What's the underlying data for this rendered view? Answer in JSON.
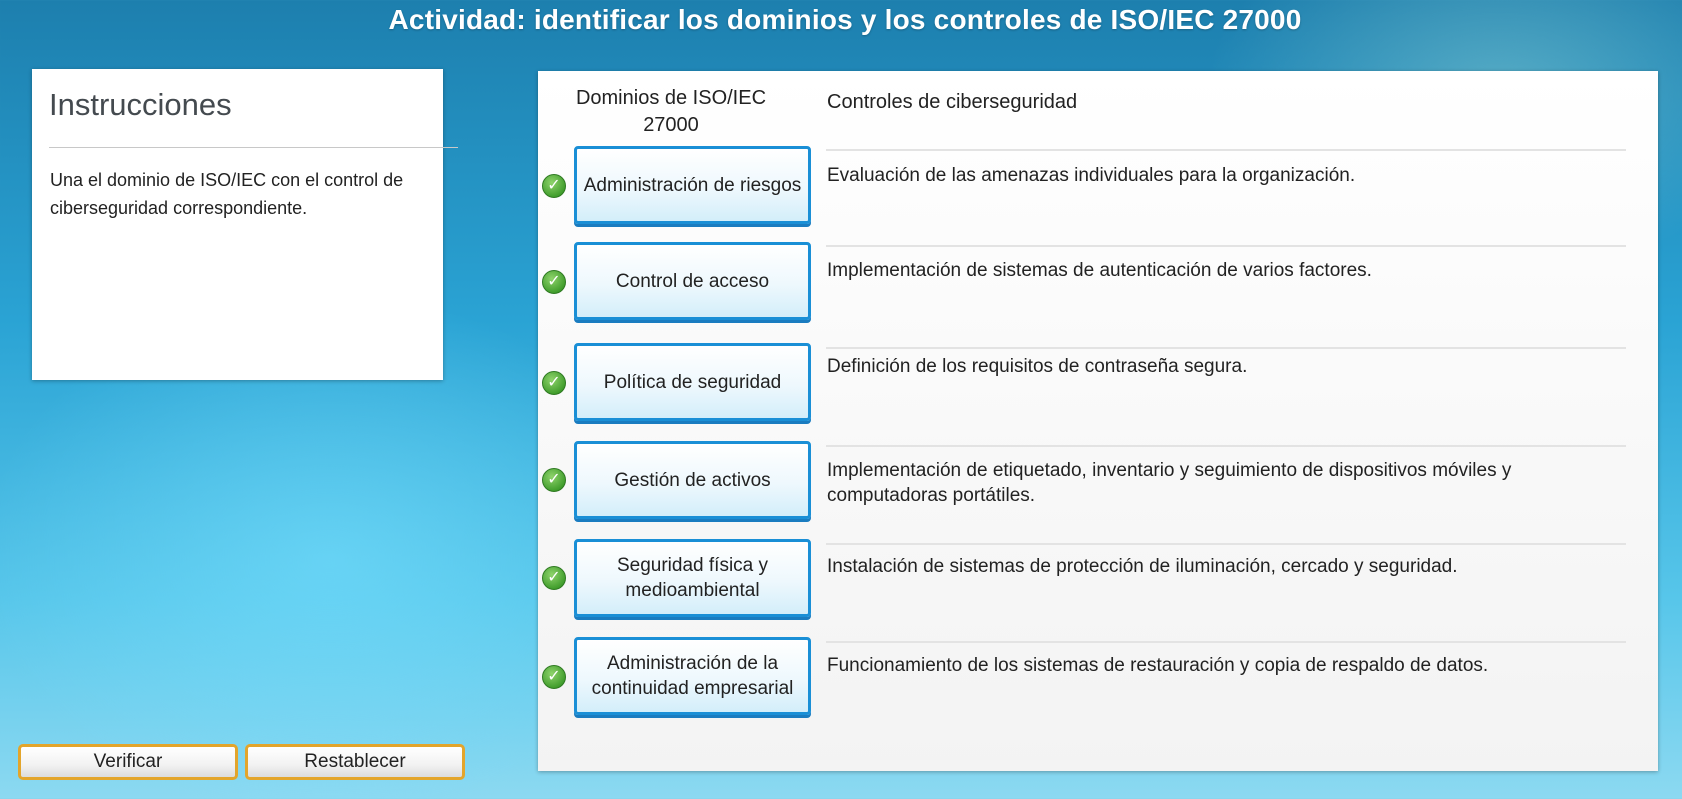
{
  "title": "Actividad: identificar los dominios y los controles de ISO/IEC 27000",
  "instructions": {
    "heading": "Instrucciones",
    "text": "Una el dominio de ISO/IEC con el control de ciberseguridad correspondiente."
  },
  "activity": {
    "domains_header": "Dominios de ISO/IEC 27000",
    "controls_header": "Controles de ciberseguridad",
    "rows": [
      {
        "domain": "Administración de riesgos",
        "control": "Evaluación de las amenazas individuales para la organización.",
        "status": "correct"
      },
      {
        "domain": "Control de acceso",
        "control": "Implementación de sistemas de autenticación de varios factores.",
        "status": "correct"
      },
      {
        "domain": "Política de seguridad",
        "control": "Definición de los requisitos de contraseña segura.",
        "status": "correct"
      },
      {
        "domain": "Gestión de activos",
        "control": "Implementación de etiquetado, inventario y seguimiento de dispositivos móviles y computadoras portátiles.",
        "status": "correct"
      },
      {
        "domain": "Seguridad física y medioambiental",
        "control": "Instalación de sistemas de protección de iluminación, cercado y seguridad.",
        "status": "correct"
      },
      {
        "domain": "Administración de la continuidad empresarial",
        "control": "Funcionamiento de los sistemas de restauración y copia de respaldo de datos.",
        "status": "correct"
      }
    ]
  },
  "buttons": {
    "verify": "Verificar",
    "reset": "Restablecer"
  },
  "icons": {
    "check": "check-circle-icon"
  },
  "colors": {
    "card_border": "#1a8fd6",
    "button_border": "#e3a52b",
    "check_green": "#3e9b2a"
  }
}
